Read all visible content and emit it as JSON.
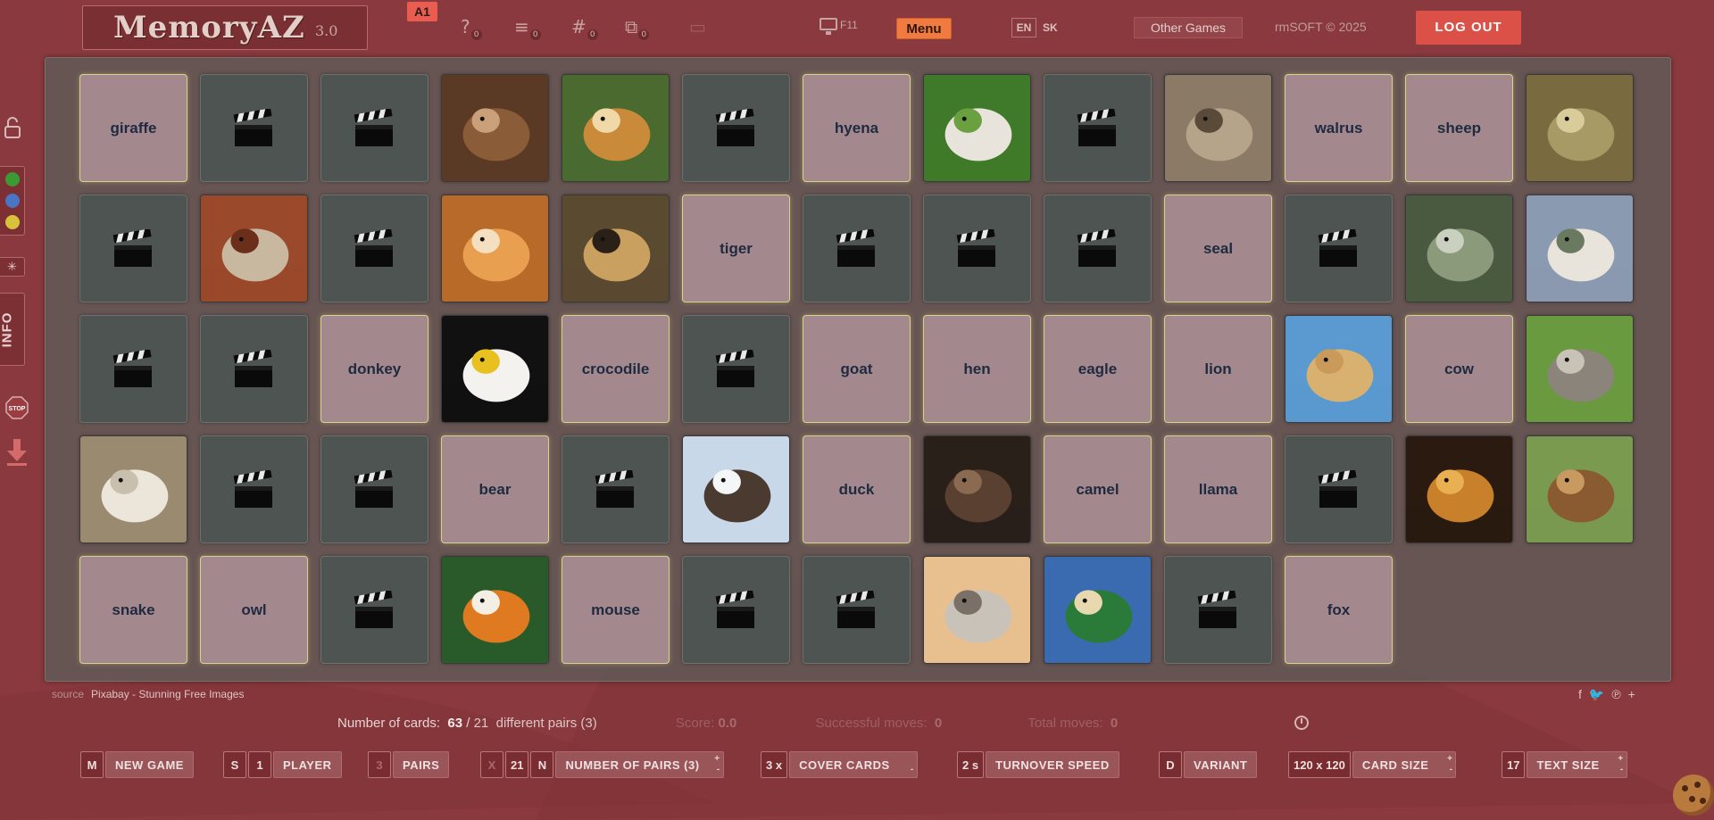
{
  "header": {
    "logo_name": "MemoryAZ",
    "logo_version": "3.0",
    "level_badge": "A1",
    "icon_counts": {
      "help": "0",
      "list": "0",
      "hash": "0",
      "puzzle": "0"
    },
    "fullscreen_key": "F11",
    "menu_label": "Menu",
    "lang_en": "EN",
    "lang_sk": "SK",
    "other_games": "Other Games",
    "copyright": "rmSOFT © 2025",
    "logout_label": "LOG OUT"
  },
  "sidebar": {
    "info_label": "INFO",
    "stop_label": "STOP"
  },
  "board": {
    "rows": [
      [
        {
          "t": "word",
          "label": "giraffe"
        },
        {
          "t": "cover"
        },
        {
          "t": "cover"
        },
        {
          "t": "photo",
          "animal": "mouse"
        },
        {
          "t": "photo",
          "animal": "giraffe"
        },
        {
          "t": "cover"
        },
        {
          "t": "word",
          "label": "hyena"
        },
        {
          "t": "photo",
          "animal": "goat"
        },
        {
          "t": "cover"
        },
        {
          "t": "photo",
          "animal": "hyena"
        },
        {
          "t": "word",
          "label": "walrus"
        },
        {
          "t": "word",
          "label": "sheep"
        },
        {
          "t": "photo",
          "animal": "snake"
        }
      ],
      [
        {
          "t": "cover"
        },
        {
          "t": "photo",
          "animal": "hen"
        },
        {
          "t": "cover"
        },
        {
          "t": "photo",
          "animal": "fox"
        },
        {
          "t": "photo",
          "animal": "owl"
        },
        {
          "t": "word",
          "label": "tiger"
        },
        {
          "t": "cover"
        },
        {
          "t": "cover"
        },
        {
          "t": "cover"
        },
        {
          "t": "word",
          "label": "seal"
        },
        {
          "t": "cover"
        },
        {
          "t": "photo",
          "animal": "crocodile"
        },
        {
          "t": "photo",
          "animal": "llama"
        }
      ],
      [
        {
          "t": "cover"
        },
        {
          "t": "cover"
        },
        {
          "t": "word",
          "label": "donkey"
        },
        {
          "t": "photo",
          "animal": "eagle"
        },
        {
          "t": "word",
          "label": "crocodile"
        },
        {
          "t": "cover"
        },
        {
          "t": "word",
          "label": "goat"
        },
        {
          "t": "word",
          "label": "hen"
        },
        {
          "t": "word",
          "label": "eagle"
        },
        {
          "t": "word",
          "label": "lion"
        },
        {
          "t": "photo",
          "animal": "camel"
        },
        {
          "t": "word",
          "label": "cow"
        },
        {
          "t": "photo",
          "animal": "donkey"
        }
      ],
      [
        {
          "t": "photo",
          "animal": "sheep"
        },
        {
          "t": "cover"
        },
        {
          "t": "cover"
        },
        {
          "t": "word",
          "label": "bear"
        },
        {
          "t": "cover"
        },
        {
          "t": "photo",
          "animal": "walrus"
        },
        {
          "t": "word",
          "label": "duck"
        },
        {
          "t": "photo",
          "animal": "bear"
        },
        {
          "t": "word",
          "label": "camel"
        },
        {
          "t": "word",
          "label": "llama"
        },
        {
          "t": "cover"
        },
        {
          "t": "photo",
          "animal": "lion"
        },
        {
          "t": "photo",
          "animal": "cow"
        }
      ],
      [
        {
          "t": "word",
          "label": "snake"
        },
        {
          "t": "word",
          "label": "owl"
        },
        {
          "t": "cover"
        },
        {
          "t": "photo",
          "animal": "tiger"
        },
        {
          "t": "word",
          "label": "mouse"
        },
        {
          "t": "cover"
        },
        {
          "t": "cover"
        },
        {
          "t": "photo",
          "animal": "seal"
        },
        {
          "t": "photo",
          "animal": "duck"
        },
        {
          "t": "cover"
        },
        {
          "t": "word",
          "label": "fox"
        }
      ]
    ]
  },
  "footer": {
    "source_label": "source",
    "source_link": "Pixabay - Stunning Free Images",
    "stats": {
      "cards_label": "Number of cards:",
      "cards_value": "63",
      "pairs_value": "21",
      "pairs_suffix": "different pairs (3)",
      "score_label": "Score:",
      "score_value": "0.0",
      "successful_label": "Successful moves:",
      "successful_value": "0",
      "total_label": "Total moves:",
      "total_value": "0"
    },
    "controls": {
      "new_game": {
        "key": "M",
        "label": "NEW GAME"
      },
      "player": {
        "key1": "S",
        "key2": "1",
        "label": "PLAYER"
      },
      "pairs": {
        "key": "3",
        "label": "PAIRS"
      },
      "number_of_pairs": {
        "key1": "X",
        "key2": "21",
        "key3": "N",
        "label": "NUMBER OF PAIRS (3)"
      },
      "cover_cards": {
        "key": "3 x",
        "label": "COVER CARDS"
      },
      "turnover_speed": {
        "key": "2 s",
        "label": "TURNOVER SPEED"
      },
      "variant": {
        "key": "D",
        "label": "VARIANT"
      },
      "card_size": {
        "key": "120 x 120",
        "label": "CARD SIZE"
      },
      "text_size": {
        "key": "17",
        "label": "TEXT SIZE"
      }
    }
  },
  "colors": {
    "background": "#8a3a3e",
    "accent": "#f07a3f",
    "logout": "#dc5147",
    "word_card": "#a3898d",
    "cover_card": "#4e5452"
  }
}
